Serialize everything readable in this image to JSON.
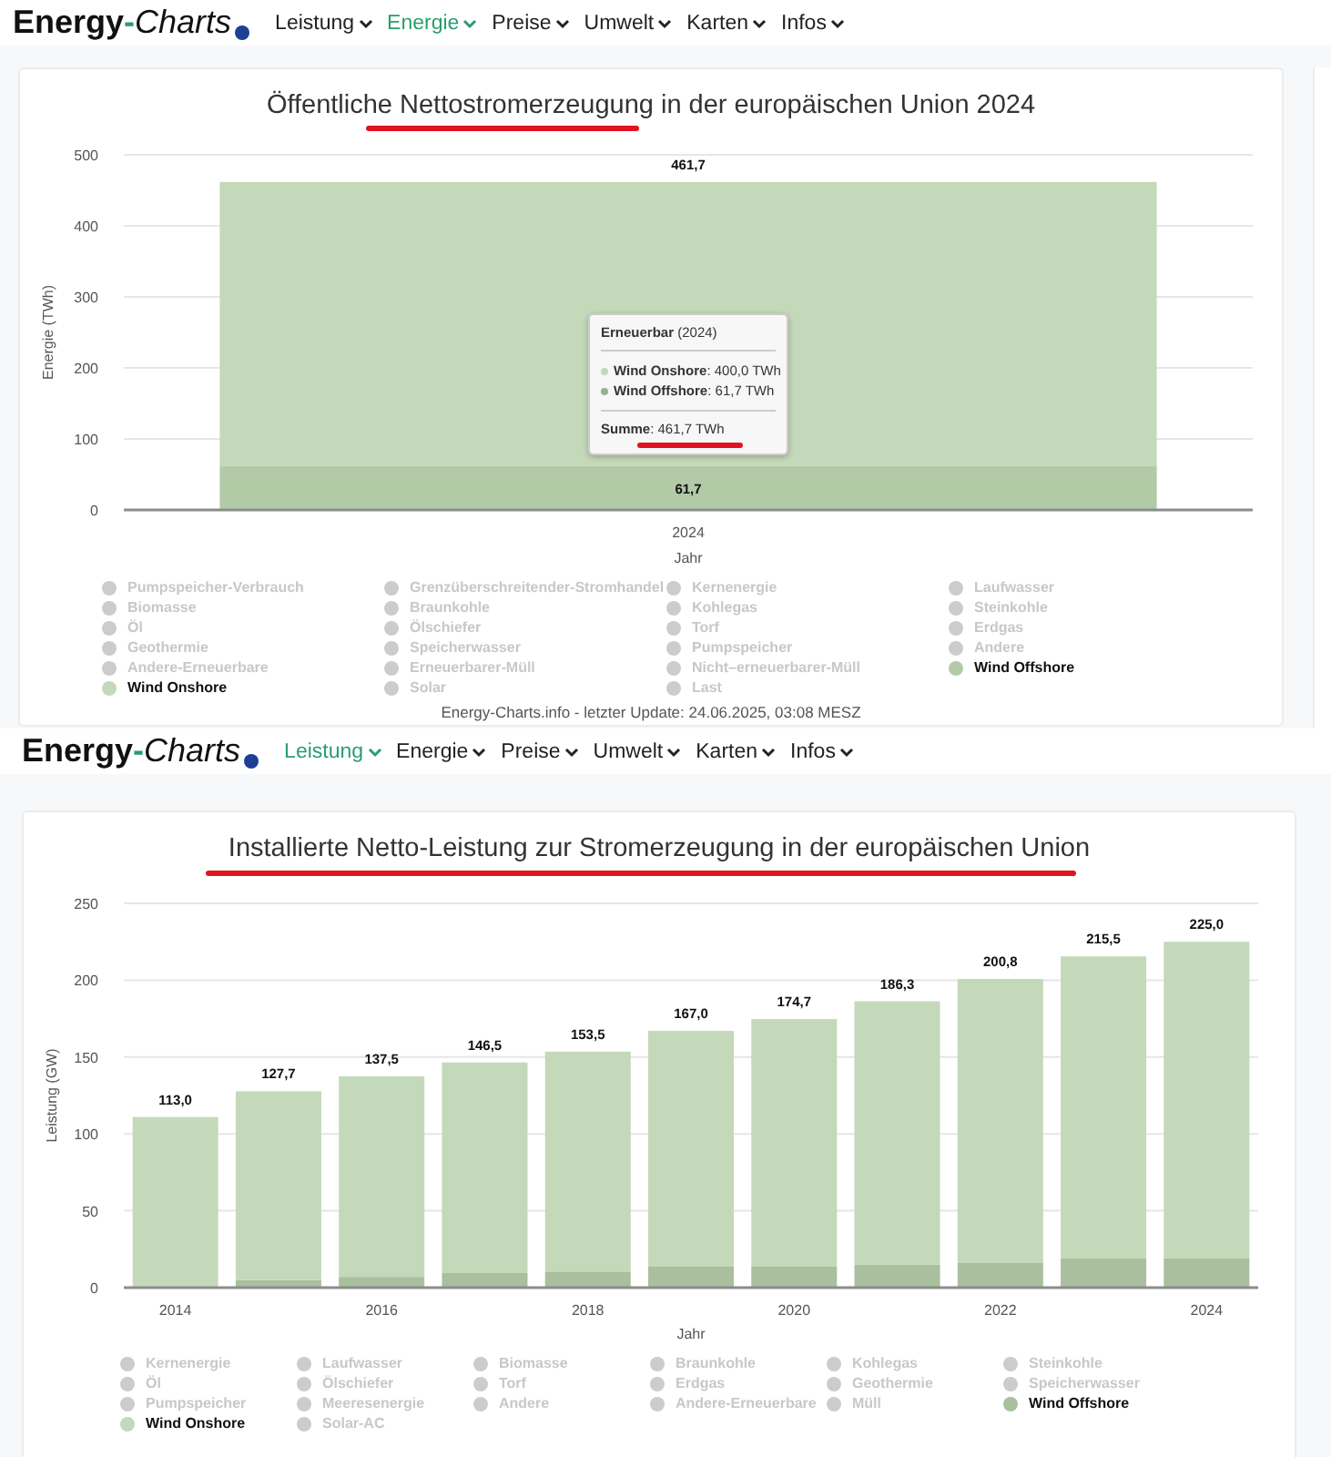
{
  "screens": [
    {
      "logo": {
        "word": "Energy",
        "dash": "-",
        "tail": "Charts"
      },
      "nav": [
        {
          "label": "Leistung",
          "selected": false
        },
        {
          "label": "Energie",
          "selected": true
        },
        {
          "label": "Preise",
          "selected": false
        },
        {
          "label": "Umwelt",
          "selected": false
        },
        {
          "label": "Karten",
          "selected": false
        },
        {
          "label": "Infos",
          "selected": false
        }
      ],
      "title": {
        "text": "Öffentliche Nettostromerzeugung in der europäischen Union 2024",
        "underlined": true
      },
      "chart_data": {
        "type": "bar",
        "stacked": true,
        "grid": true,
        "legend": "bottom",
        "xlabel": "Jahr",
        "ylabel": "Energie (TWh)",
        "categories": [
          "2024"
        ],
        "ylim": [
          0,
          500
        ],
        "yticks": [
          0,
          100,
          200,
          300,
          400,
          500
        ],
        "series": [
          {
            "name": "Wind Offshore",
            "color": "#b3caa7",
            "values": [
              61.7
            ],
            "value_labels": [
              "61,7"
            ]
          },
          {
            "name": "Wind Onshore",
            "color": "#c4d9b9",
            "values": [
              400.0
            ]
          }
        ],
        "value_labels": [
          "461,7"
        ]
      },
      "legend_items": [
        {
          "kind": "inactive",
          "label": "Pumpspeicher-Verbrauch"
        },
        {
          "kind": "inactive",
          "label": "Grenzüberschreitender-Stromhandel"
        },
        {
          "kind": "inactive",
          "label": "Kernenergie"
        },
        {
          "kind": "inactive",
          "label": "Laufwasser"
        },
        {
          "kind": "inactive",
          "label": "Biomasse"
        },
        {
          "kind": "inactive",
          "label": "Braunkohle"
        },
        {
          "kind": "inactive",
          "label": "Kohlegas"
        },
        {
          "kind": "inactive",
          "label": "Steinkohle"
        },
        {
          "kind": "inactive",
          "label": "Öl"
        },
        {
          "kind": "inactive",
          "label": "Ölschiefer"
        },
        {
          "kind": "inactive",
          "label": "Torf"
        },
        {
          "kind": "inactive",
          "label": "Erdgas"
        },
        {
          "kind": "inactive",
          "label": "Geothermie"
        },
        {
          "kind": "inactive",
          "label": "Speicherwasser"
        },
        {
          "kind": "inactive",
          "label": "Pumpspeicher"
        },
        {
          "kind": "inactive",
          "label": "Andere"
        },
        {
          "kind": "inactive",
          "label": "Andere-Erneuerbare"
        },
        {
          "kind": "inactive",
          "label": "Erneuerbarer-Müll"
        },
        {
          "kind": "inactive",
          "label": "Nicht–erneuerbarer-Müll"
        },
        {
          "kind": "series"
        },
        {
          "kind": "series"
        },
        {
          "kind": "inactive",
          "label": "Solar"
        },
        {
          "kind": "inactive",
          "label": "Last"
        }
      ],
      "tooltip": {
        "heading": "**Erneuerbar** (2024)",
        "rows": [
          {
            "text": "**Wind Onshore**: 400,0 TWh",
            "color": "#c4d9b9"
          },
          {
            "text": "**Wind Offshore**: 61,7 TWh",
            "color": "#98b08c"
          }
        ],
        "sum": "**Summe**: 461,7 TWh",
        "underlined": true
      },
      "footer": "Energy-Charts.info - letzter Update: 24.06.2025, 03:08 MESZ"
    },
    {
      "logo": {
        "word": "Energy",
        "dash": "-",
        "tail": "Charts"
      },
      "nav": [
        {
          "label": "Leistung",
          "selected": true
        },
        {
          "label": "Energie",
          "selected": false
        },
        {
          "label": "Preise",
          "selected": false
        },
        {
          "label": "Umwelt",
          "selected": false
        },
        {
          "label": "Karten",
          "selected": false
        },
        {
          "label": "Infos",
          "selected": false
        }
      ],
      "title": {
        "text": "Installierte Netto-Leistung zur Stromerzeugung in der europäischen Union",
        "underlined": true
      },
      "chart_data": {
        "type": "bar",
        "stacked": true,
        "grid": true,
        "legend": "bottom",
        "xlabel": "Jahr",
        "ylabel": "Leistung (GW)",
        "x": [
          2014,
          2015,
          2016,
          2017,
          2018,
          2019,
          2020,
          2021,
          2022,
          2023,
          2024
        ],
        "xlim": [
          2013.5,
          2024.5
        ],
        "xticks": [
          2014,
          2016,
          2018,
          2020,
          2022,
          2024
        ],
        "ylim": [
          0,
          250
        ],
        "yticks": [
          0,
          50,
          100,
          150,
          200,
          250
        ],
        "series": [
          {
            "name": "Wind Offshore",
            "color": "#a9bf9d",
            "values": [
              null,
              5.0,
              7.0,
              9.5,
              10.5,
              14.0,
              14.0,
              15.0,
              16.0,
              19.0,
              19.0
            ]
          },
          {
            "name": "Wind Onshore",
            "color": "#c4d9b9",
            "values": [
              111.0,
              122.7,
              130.5,
              137.0,
              143.0,
              153.0,
              160.7,
              171.3,
              184.8,
              196.5,
              206.0
            ]
          }
        ],
        "value_labels": [
          "113,0",
          "127,7",
          "137,5",
          "146,5",
          "153,5",
          "167,0",
          "174,7",
          "186,3",
          "200,8",
          "215,5",
          "225,0"
        ]
      },
      "legend_items": [
        {
          "kind": "inactive",
          "label": "Kernenergie"
        },
        {
          "kind": "inactive",
          "label": "Laufwasser"
        },
        {
          "kind": "inactive",
          "label": "Biomasse"
        },
        {
          "kind": "inactive",
          "label": "Braunkohle"
        },
        {
          "kind": "inactive",
          "label": "Kohlegas"
        },
        {
          "kind": "inactive",
          "label": "Steinkohle"
        },
        {
          "kind": "inactive",
          "label": "Öl"
        },
        {
          "kind": "inactive",
          "label": "Ölschiefer"
        },
        {
          "kind": "inactive",
          "label": "Torf"
        },
        {
          "kind": "inactive",
          "label": "Erdgas"
        },
        {
          "kind": "inactive",
          "label": "Geothermie"
        },
        {
          "kind": "inactive",
          "label": "Speicherwasser"
        },
        {
          "kind": "inactive",
          "label": "Pumpspeicher"
        },
        {
          "kind": "inactive",
          "label": "Meeresenergie"
        },
        {
          "kind": "inactive",
          "label": "Andere"
        },
        {
          "kind": "inactive",
          "label": "Andere-Erneuerbare"
        },
        {
          "kind": "inactive",
          "label": "Müll"
        },
        {
          "kind": "series"
        },
        {
          "kind": "series"
        },
        {
          "kind": "inactive",
          "label": "Solar-AC"
        }
      ]
    }
  ]
}
